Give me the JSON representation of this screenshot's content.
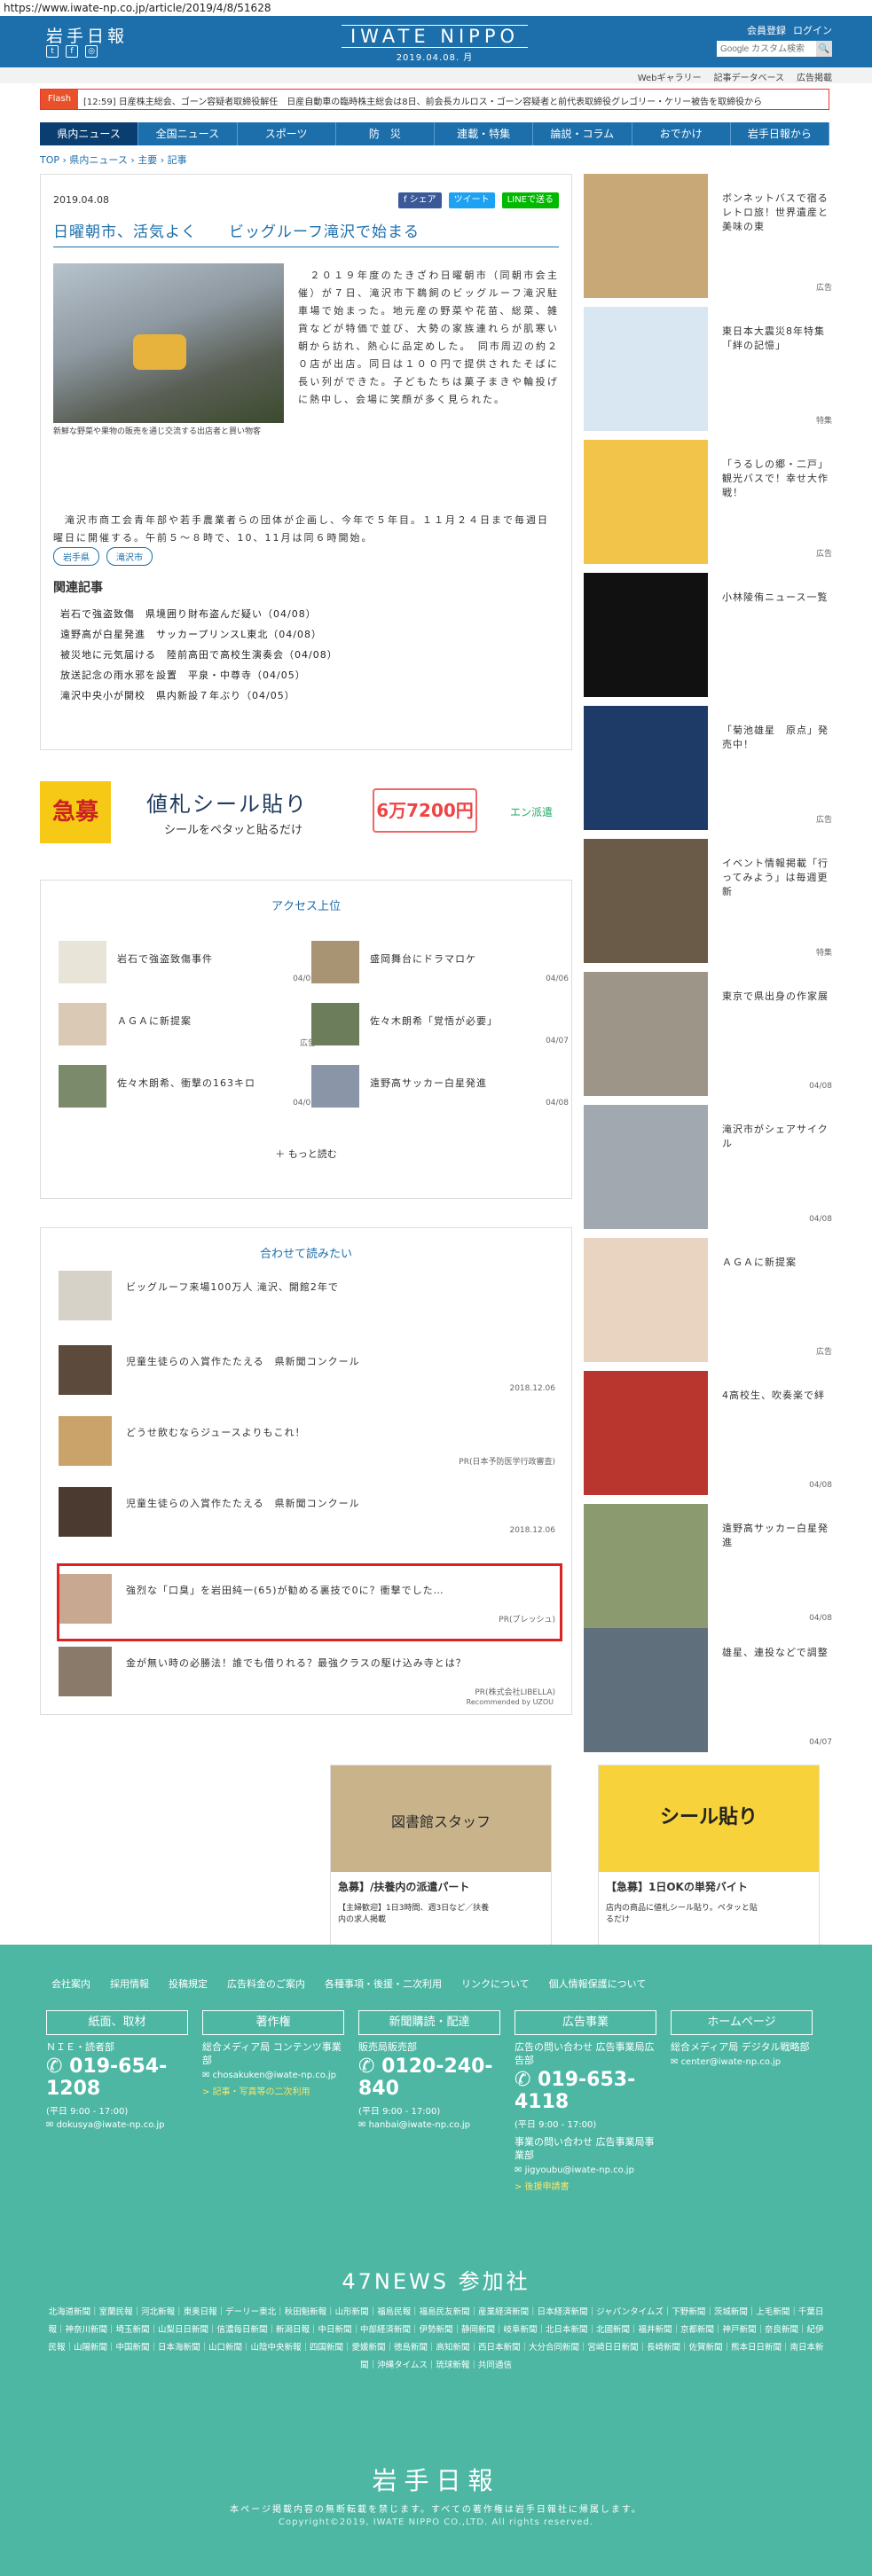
{
  "url": "https://www.iwate-np.co.jp/article/2019/4/8/51628",
  "header": {
    "logo": "岩手日報",
    "brand": "IWATE NIPPO",
    "date": "2019.04.08. 月",
    "links": [
      "会員登録",
      "ログイン"
    ],
    "search_placeholder": "Google カスタム検索",
    "search_btn": "🔍"
  },
  "subnav": [
    "Webギャラリー",
    "記事データベース",
    "広告掲載"
  ],
  "flash": {
    "tag": "Flash",
    "text": "[12:59] 日産株主総会、ゴーン容疑者取締役解任　日産自動車の臨時株主総会は8日、前会長カルロス・ゴーン容疑者と前代表取締役グレゴリー・ケリー被告を取締役から"
  },
  "nav": [
    "県内ニュース",
    "全国ニュース",
    "スポーツ",
    "防　災",
    "連載・特集",
    "論説・コラム",
    "おでかけ",
    "岩手日報から"
  ],
  "breadcrumb": "TOP › 県内ニュース › 主要 › 記事",
  "article": {
    "date": "2019.04.08",
    "share": [
      "f シェア",
      "ツイート",
      "LINEで送る"
    ],
    "title": "日曜朝市、活気よく　　ビッグルーフ滝沢で始まる",
    "caption": "新鮮な野菜や果物の販売を通じ交流する出店者と買い物客",
    "body": "　２０１９年度のたきざわ日曜朝市（同朝市会主催）が７日、滝沢市下鵜飼のビッグルーフ滝沢駐車場で始まった。地元産の野菜や花苗、総菜、雑貨などが特価で並び、大勢の家族連れらが肌寒い朝から訪れ、熱心に品定めした。　同市周辺の約２０店が出店。同日は１００円で提供されたそばに長い列ができた。子どもたちは菓子まきや輪投げに熱中し、会場に笑顔が多く見られた。",
    "body2": "　滝沢市商工会青年部や若手農業者らの団体が企画し、今年で５年目。１１月２４日まで毎週日曜日に開催する。午前５〜８時で、10、11月は同６時開始。",
    "tags": [
      "岩手県",
      "滝沢市"
    ],
    "related_head": "関連記事",
    "related": [
      "岩石で強盗致傷　県境囲り財布盗んだ疑い（04/08）",
      "遠野高が白星発進　サッカープリンスL東北（04/08）",
      "被災地に元気届ける　陸前高田で高校生演奏会（04/08）",
      "放送記念の雨水邪を設置　平泉・中尊寺（04/05）",
      "滝沢中央小が開校　県内新設７年ぶり（04/05）"
    ]
  },
  "ad": {
    "tag": "急募",
    "main": "値札シール貼り",
    "sub": "シールをペタッと貼るだけ",
    "price": "6万7200円",
    "logo": "エン派遣"
  },
  "access": {
    "title": "アクセス上位",
    "items": [
      {
        "t": "岩石で強盗致傷事件",
        "d": "04/08"
      },
      {
        "t": "盛岡舞台にドラマロケ",
        "d": "04/06"
      },
      {
        "t": "ＡＧＡに新提案",
        "d": "広告"
      },
      {
        "t": "佐々木朗希「覚悟が必要」",
        "d": "04/07"
      },
      {
        "t": "佐々木朗希、衝撃の163キロ",
        "d": "04/07"
      },
      {
        "t": "遠野高サッカー白星発進",
        "d": "04/08"
      }
    ],
    "more": "もっと読む"
  },
  "recommend": {
    "title": "合わせて読みたい",
    "items": [
      {
        "t": "ビッグルーフ来場100万人 滝沢、開館2年で",
        "d": ""
      },
      {
        "t": "児童生徒らの入賞作たたえる　県新聞コンクール",
        "d": "2018.12.06"
      },
      {
        "t": "どうせ飲むならジュースよりもこれ！",
        "d": "PR(日本予防医学行政審査)"
      },
      {
        "t": "児童生徒らの入賞作たたえる　県新聞コンクール",
        "d": "2018.12.06"
      },
      {
        "t": "強烈な「口臭」を岩田純一(65)が勧める裏技で0に？衝撃でした…",
        "d": "PR(ブレッシュ)"
      },
      {
        "t": "金が無い時の必勝法！誰でも借りれる？最強クラスの駆け込み寺とは？",
        "d": "PR(株式会社LIBELLA)"
      }
    ],
    "footer": "Recommended by UZOU"
  },
  "ads_bottom": [
    {
      "head": "図書館スタッフ",
      "title": "急募】/扶養内の派遣パート",
      "sub": "【主婦歓迎】1日3時間、週3日など／扶養内の求人掲載"
    },
    {
      "head": "シール貼り",
      "title": "【急募】1日OKの単発バイト",
      "sub": "店内の商品に値札シール貼り。ペタッと貼るだけ"
    }
  ],
  "sidebar": [
    {
      "t": "ボンネットバスで宿るレトロ旅！世界遺産と美味の東",
      "c": "広告"
    },
    {
      "t": "東日本大震災8年特集「絆の記憶」",
      "c": "特集"
    },
    {
      "t": "「うるしの郷・二戸」観光バスで！幸せ大作戦！",
      "c": "広告"
    },
    {
      "t": "小林陵侑ニュース一覧",
      "c": ""
    },
    {
      "t": "「菊池雄星　原点」発売中！",
      "c": "広告"
    },
    {
      "t": "イベント情報掲載「行ってみよう」は毎週更新",
      "c": "特集"
    },
    {
      "t": "東京で県出身の作家展",
      "c": "04/08"
    },
    {
      "t": "滝沢市がシェアサイクル",
      "c": "04/08"
    },
    {
      "t": "ＡＧＡに新提案",
      "c": "広告"
    },
    {
      "t": "4高校生、吹奏楽で絆",
      "c": "04/08"
    },
    {
      "t": "遠野高サッカー白星発進",
      "c": "04/08"
    },
    {
      "t": "雄星、連投などで調整",
      "c": "04/07"
    }
  ],
  "footer": {
    "links": [
      "会社案内",
      "採用情報",
      "投稿規定",
      "広告料金のご案内",
      "各種事項・後援・二次利用",
      "リンクについて",
      "個人情報保護について"
    ],
    "cols": [
      {
        "hd": "紙面、取材",
        "ln": "ＮＩＥ・読者部",
        "ph": "019-654-1208",
        "hours": "(平日 9:00 - 17:00)",
        "em": "dokusya@iwate-np.co.jp"
      },
      {
        "hd": "著作権",
        "ln": "総合メディア局 コンテンツ事業部",
        "ph": "",
        "hours": "",
        "em": "chosakuken@iwate-np.co.jp",
        "gl": "> 記事・写真等の二次利用"
      },
      {
        "hd": "新聞購読・配達",
        "ln": "販売局販売部",
        "ph": "0120-240-840",
        "hours": "(平日 9:00 - 17:00)",
        "em": "hanbai@iwate-np.co.jp"
      },
      {
        "hd": "広告事業",
        "ln": "広告の問い合わせ 広告事業局広告部",
        "ph": "019-653-4118",
        "hours": "(平日 9:00 - 17:00)",
        "em": "jigyoubu@iwate-np.co.jp",
        "gl": "> 後援申請書",
        "ln2": "事業の問い合わせ 広告事業局事業部"
      },
      {
        "hd": "ホームページ",
        "ln": "総合メディア局 デジタル戦略部",
        "ph": "",
        "hours": "",
        "em": "center@iwate-np.co.jp"
      }
    ],
    "news47": "47NEWS 参加社",
    "papers": "北海道新聞｜室蘭民報｜河北新報｜東奥日報｜デーリー東北｜秋田魁新報｜山形新聞｜福島民報｜福島民友新聞｜産業経済新聞｜日本経済新聞｜ジャパンタイムズ｜下野新聞｜茨城新聞｜上毛新聞｜千葉日報｜神奈川新聞｜埼玉新聞｜山梨日日新聞｜信濃毎日新聞｜新潟日報｜中日新聞｜中部経済新聞｜伊勢新聞｜静岡新聞｜岐阜新聞｜北日本新聞｜北國新聞｜福井新聞｜京都新聞｜神戸新聞｜奈良新聞｜紀伊民報｜山陽新聞｜中国新聞｜日本海新聞｜山口新聞｜山陰中央新報｜四国新聞｜愛媛新聞｜徳島新聞｜高知新聞｜西日本新聞｜大分合同新聞｜宮崎日日新聞｜長崎新聞｜佐賀新聞｜熊本日日新聞｜南日本新聞｜沖縄タイムス｜琉球新報｜共同通信",
    "brand": "岩手日報",
    "note": "本ページ掲載内容の無断転載を禁じます。すべての著作権は岩手日報社に帰属します。",
    "copy": "Copyright©2019, IWATE NIPPO CO.,LTD. All rights reserved."
  }
}
